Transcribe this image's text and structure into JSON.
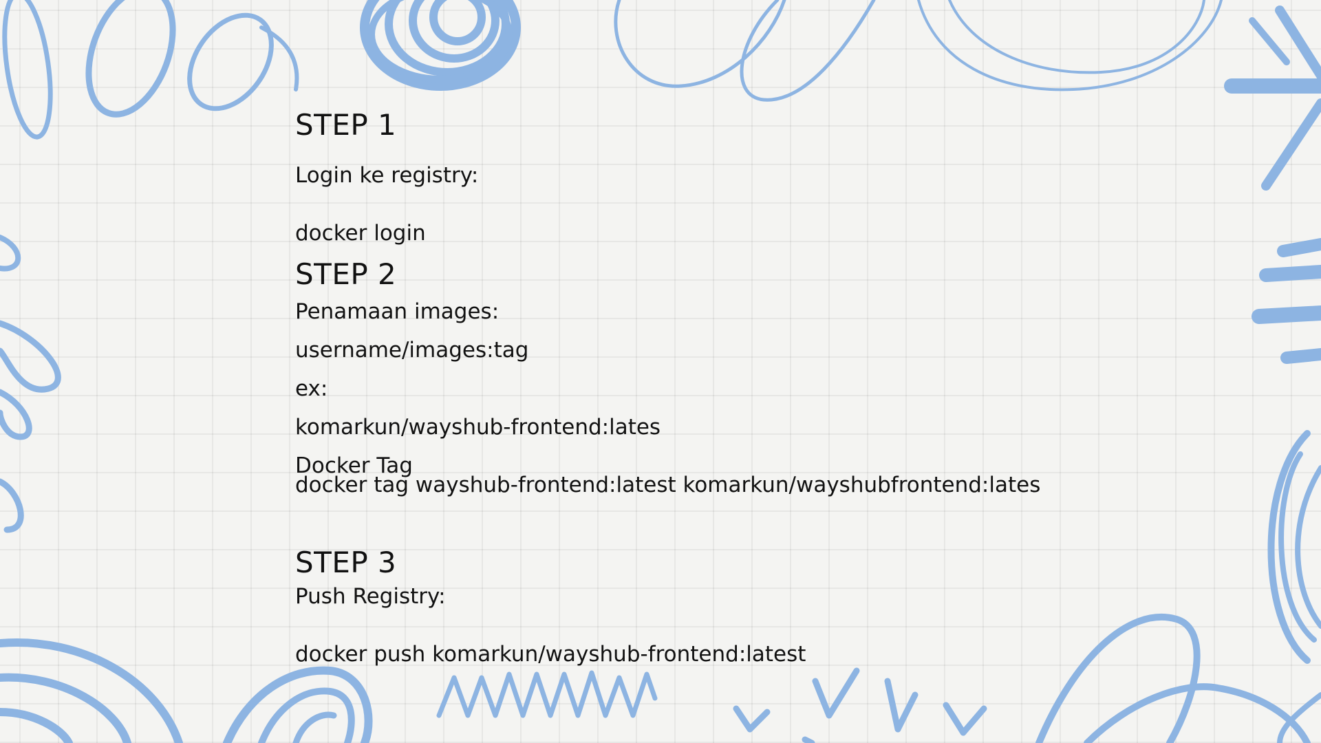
{
  "slide": {
    "step1": {
      "heading": "STEP 1",
      "line1": "Login ke registry:",
      "line2": "docker login"
    },
    "step2": {
      "heading": "STEP 2",
      "line1": "Penamaan images:",
      "line2": "username/images:tag",
      "line3": "ex:",
      "line4": "komarkun/wayshub-frontend:lates",
      "line5": "Docker Tag",
      "line6": "docker tag wayshub-frontend:latest komarkun/wayshubfrontend:lates"
    },
    "step3": {
      "heading": "STEP 3",
      "line1": "Push Registry:",
      "line2": "docker push komarkun/wayshub-frontend:latest"
    }
  },
  "colors": {
    "background": "#f4f4f2",
    "doodle": "#8db4e2",
    "text": "#111111"
  }
}
